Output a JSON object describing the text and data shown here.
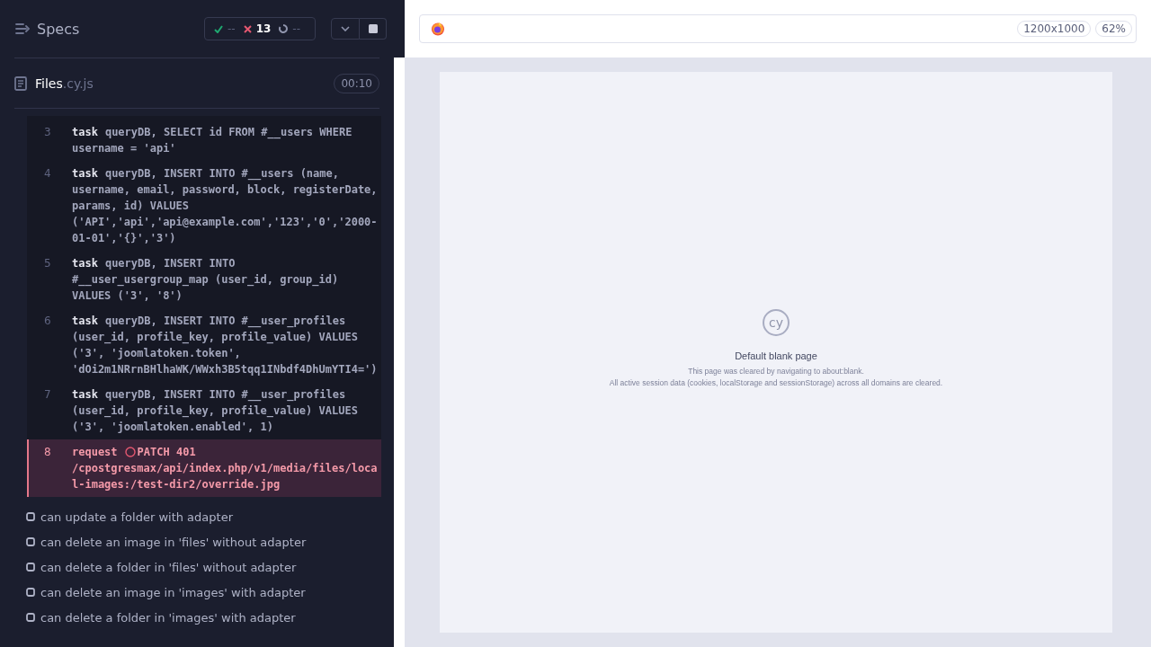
{
  "header": {
    "title": "Specs",
    "stats": {
      "passed": "--",
      "failed": "13",
      "pending": "--"
    }
  },
  "spec": {
    "name": "Files",
    "extension": ".cy.js",
    "duration": "00:10"
  },
  "commands": [
    {
      "number": "3",
      "kind": "task",
      "name": "task",
      "message": "queryDB, SELECT id FROM #__users WHERE username = 'api'",
      "failed": false
    },
    {
      "number": "4",
      "kind": "task",
      "name": "task",
      "message": "queryDB, INSERT INTO #__users (name, username, email, password, block, registerDate, params, id) VALUES ('API','api','api@example.com','123','0','2000-01-01','{}','3')",
      "failed": false
    },
    {
      "number": "5",
      "kind": "task",
      "name": "task",
      "message": "queryDB, INSERT INTO #__user_usergroup_map (user_id, group_id) VALUES ('3', '8')",
      "failed": false
    },
    {
      "number": "6",
      "kind": "task",
      "name": "task",
      "message": "queryDB, INSERT INTO #__user_profiles (user_id, profile_key, profile_value) VALUES ('3', 'joomlatoken.token', 'dOi2m1NRrnBHlhaWK/WWxh3B5tqq1INbdf4DhUmYTI4=')",
      "failed": false
    },
    {
      "number": "7",
      "kind": "task",
      "name": "task",
      "message": "queryDB, INSERT INTO #__user_profiles (user_id, profile_key, profile_value) VALUES ('3', 'joomlatoken.enabled', 1)",
      "failed": false
    },
    {
      "number": "8",
      "kind": "request",
      "name": "request",
      "message": "PATCH 401 /cpostgresmax/api/index.php/v1/media/files/local-images:/test-dir2/override.jpg",
      "failed": true
    }
  ],
  "tests": [
    {
      "title": "can update a folder with adapter"
    },
    {
      "title": "can delete an image in 'files' without adapter"
    },
    {
      "title": "can delete a folder in 'files' without adapter"
    },
    {
      "title": "can delete an image in 'images' with adapter"
    },
    {
      "title": "can delete a folder in 'images' with adapter"
    }
  ],
  "browser": {
    "viewport": "1200x1000",
    "zoom": "62%"
  },
  "blank_page": {
    "logo_text": "cy",
    "title": "Default blank page",
    "lines": [
      "This page was cleared by navigating to about:blank.",
      "All active session data (cookies, localStorage and sessionStorage) across all domains are cleared."
    ]
  }
}
